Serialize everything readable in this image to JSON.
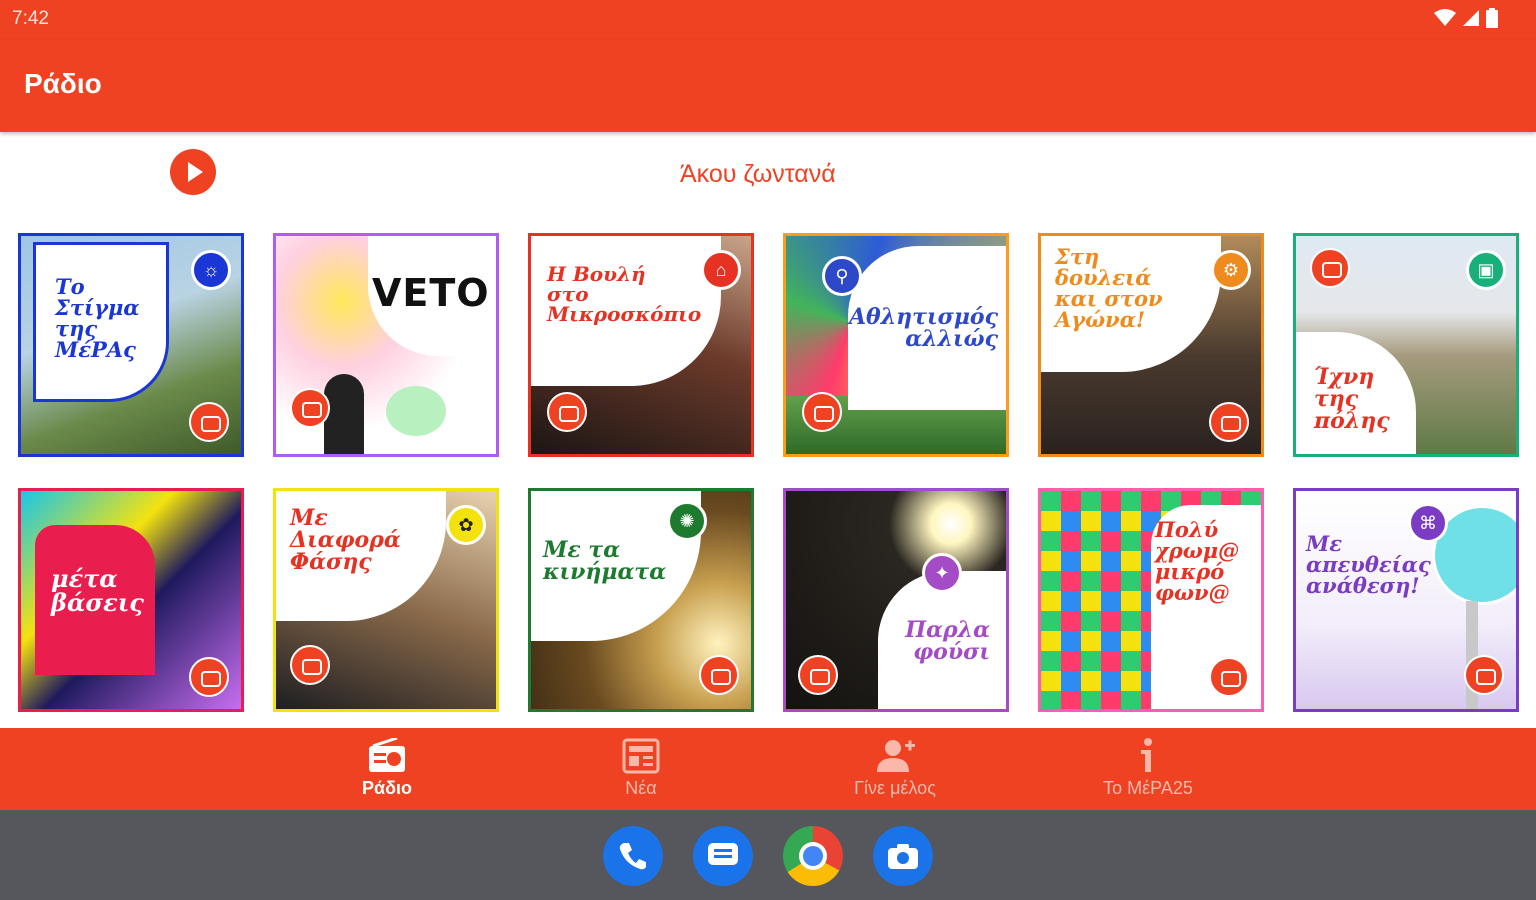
{
  "status": {
    "time": "7:42"
  },
  "app": {
    "title": "Ράδιο",
    "accent": "#ef4223"
  },
  "live": {
    "label": "Άκου ζωντανά"
  },
  "shows": [
    {
      "title": "Το\nΣτίγμα\nτης\nΜέΡΑς",
      "color": "#1a37d6"
    },
    {
      "title": "VETO",
      "color": "#b05cf0"
    },
    {
      "title": "Η Βουλή\nστο\nΜικροσκόπιο",
      "color": "#e53223"
    },
    {
      "title": "Αθλητισμός\nαλλιώς",
      "color": "#ff9b1a"
    },
    {
      "title": "Στη\nδουλειά\nκαι στον\nΑγώνα!",
      "color": "#ef8a1c"
    },
    {
      "title": "Ίχνη\nτης\nπόλης",
      "color": "#17b07a"
    },
    {
      "title": "μέτα\nβάσεις",
      "color": "#e91e4f"
    },
    {
      "title": "Με\nΔιαφορά\nΦάσης",
      "color": "#f4e20f"
    },
    {
      "title": "Με τα\nκινήματα",
      "color": "#1d7a2e"
    },
    {
      "title": "Παρλα\nφούσι",
      "color": "#a44cc6"
    },
    {
      "title": "Πολύ\nχρωμ@\nμικρό\nφων@",
      "color": "#ff5cb4"
    },
    {
      "title": "Με\nαπευθείας\nανάθεση!",
      "color": "#7a3cc2"
    }
  ],
  "nav": [
    {
      "label": "Ράδιο",
      "icon": "radio-icon",
      "active": true
    },
    {
      "label": "Νέα",
      "icon": "news-icon",
      "active": false
    },
    {
      "label": "Γίνε μέλος",
      "icon": "add-person-icon",
      "active": false
    },
    {
      "label": "Το ΜέΡΑ25",
      "icon": "info-icon",
      "active": false
    }
  ],
  "dock": [
    "phone-icon",
    "messages-icon",
    "chrome-icon",
    "camera-icon"
  ]
}
